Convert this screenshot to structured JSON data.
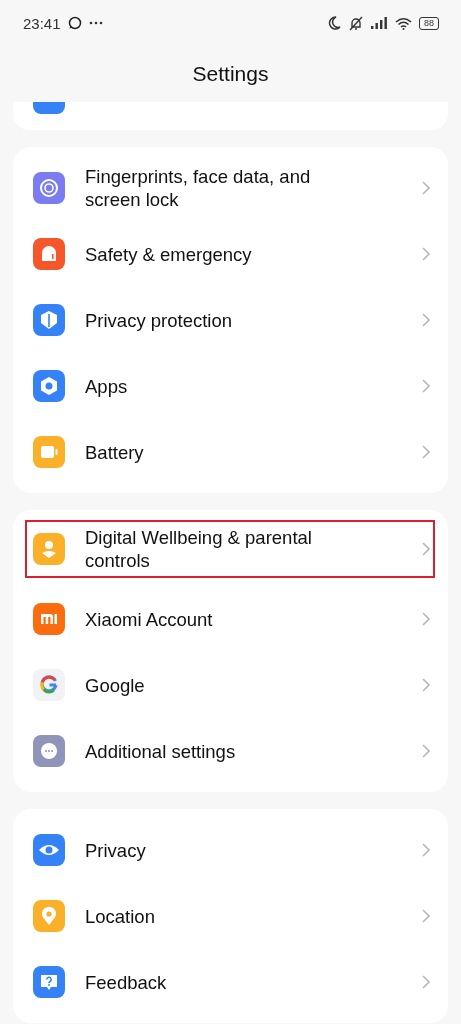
{
  "status_bar": {
    "time": "23:41",
    "battery": "88"
  },
  "header": {
    "title": "Settings"
  },
  "groups": [
    {
      "items": [
        {
          "label": "Fingerprints, face data, and screen lock",
          "kind": "fingerprint",
          "color": "#7b7cf2",
          "highlighted": false
        },
        {
          "label": "Safety & emergency",
          "kind": "siren",
          "color": "#f5572a",
          "highlighted": false
        },
        {
          "label": "Privacy protection",
          "kind": "shield",
          "color": "#3582f6",
          "highlighted": false
        },
        {
          "label": "Apps",
          "kind": "hexagon",
          "color": "#3582f6",
          "highlighted": false
        },
        {
          "label": "Battery",
          "kind": "battery",
          "color": "#fbb02a",
          "highlighted": false
        }
      ]
    },
    {
      "items": [
        {
          "label": "Digital Wellbeing & parental controls",
          "kind": "person",
          "color": "#fbb02a",
          "highlighted": true
        },
        {
          "label": "Xiaomi Account",
          "kind": "mi",
          "color": "#fa6c0e",
          "highlighted": false
        },
        {
          "label": "Google",
          "kind": "google",
          "color": "#f2f2f4",
          "highlighted": false
        },
        {
          "label": "Additional settings",
          "kind": "dots",
          "color": "#8f94b8",
          "highlighted": false
        }
      ]
    },
    {
      "items": [
        {
          "label": "Privacy",
          "kind": "eye",
          "color": "#3582f6",
          "highlighted": false
        },
        {
          "label": "Location",
          "kind": "pin",
          "color": "#fbb02a",
          "highlighted": false
        },
        {
          "label": "Feedback",
          "kind": "question",
          "color": "#3582f6",
          "highlighted": false
        }
      ]
    }
  ]
}
